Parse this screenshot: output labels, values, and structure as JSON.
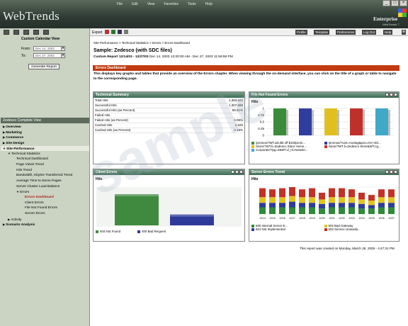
{
  "browser": {
    "menu": [
      "File",
      "Edit",
      "View",
      "Favorites",
      "Tools",
      "Help"
    ]
  },
  "brand": {
    "logo": "WebTrends",
    "edition": "Enterprise",
    "version": "WebTrends 7"
  },
  "left": {
    "title": "Custom Calendar View",
    "from_label": "From:",
    "from_value": "Dec 14, 2003",
    "to_label": "To:",
    "to_value": "Dec 27, 2003",
    "generate": "Generate Report",
    "profile": "Zedesco Complete View",
    "tree": [
      {
        "label": "Overview",
        "lvl": 0
      },
      {
        "label": "Marketing",
        "lvl": 0
      },
      {
        "label": "Commerce",
        "lvl": 0
      },
      {
        "label": "Site Design",
        "lvl": 0
      },
      {
        "label": "Site Performance",
        "lvl": 0,
        "sel": true
      },
      {
        "label": "Technical Statistics",
        "lvl": 1
      },
      {
        "label": "Technical Dashboard",
        "lvl": 2
      },
      {
        "label": "Page Views Trend",
        "lvl": 2
      },
      {
        "label": "Hits Trend",
        "lvl": 2
      },
      {
        "label": "Bandwidth, Kbytes Transferred Trend",
        "lvl": 2
      },
      {
        "label": "Average Time to Serve Pages",
        "lvl": 2
      },
      {
        "label": "Server Cluster Load Balance",
        "lvl": 2
      },
      {
        "label": "Errors",
        "lvl": 2
      },
      {
        "label": "Errors Dashboard",
        "lvl": 3,
        "hl": true
      },
      {
        "label": "Client Errors",
        "lvl": 3
      },
      {
        "label": "File Not Found Errors",
        "lvl": 3
      },
      {
        "label": "Server Errors",
        "lvl": 3
      },
      {
        "label": "Activity",
        "lvl": 1
      },
      {
        "label": "Scenario Analysis",
        "lvl": 0
      }
    ]
  },
  "topnav": {
    "export": "Export",
    "buttons": [
      "Profile",
      "Template",
      "Preferences",
      "Log Out",
      "Help"
    ]
  },
  "main": {
    "breadcrumb": "Site Performance > Technical Statistics > Errors > Errors Dashboard",
    "title": "Sample: Zedesco (with SDC files)",
    "custom_report": "Custom Report 12/14/03 - 12/27/03",
    "custom_range": "Dec 14, 2003 12:00:00 AM - Dec 27, 2003 11:59:59 PM",
    "banner": "Errors Dashboard",
    "description": "This displays key graphs and tables that provide an overview of the Errors chapter. When viewing through the on-demand interface, you can click on the title of a graph or table to navigate to the corresponding page.",
    "footer": "This report was created on Monday, March 28, 2005 - 4:47:31 PM"
  },
  "summary": {
    "title": "Technical Summary",
    "rows": [
      [
        "Total Hits",
        "1,383,622"
      ],
      [
        "Successful Hits",
        "1,307,688"
      ],
      [
        "Successful Hits (as Percent)",
        "99.91%"
      ],
      [
        "Failed Hits",
        ""
      ],
      [
        "Failed Hits (as Percent)",
        "0.09%"
      ],
      [
        "Cached Hits",
        "2,520"
      ],
      [
        "Cached Hits (as Percent)",
        "0.19%"
      ]
    ]
  },
  "fnf": {
    "title": "File Not Found Errors",
    "hits": "Hits",
    "yticks": [
      "1",
      "0.75",
      "0.5",
      "0.25",
      "0"
    ],
    "colors": [
      "#3a8c3a",
      "#2f3e9e",
      "#e0c020",
      "#c0302a",
      "#40a8c8"
    ],
    "values": [
      1,
      1,
      1,
      1,
      1
    ],
    "legend": [
      "/promos/?WT.ad=$5 off $100prom...",
      "/promos/?cart=Analog&pos=On+Vid...",
      "/store/?WT.li=Zedesco Store Home...",
      "/store/?WT.li=Zedesco Store&WT.cg...",
      "/corporate/?pg=4&WT.cl_nl=Newsle..."
    ]
  },
  "client": {
    "title": "Client Errors",
    "hits": "Hits",
    "chart_data": {
      "type": "bar",
      "categories": [
        "404 Not Found",
        "400 Bad Request"
      ],
      "values": [
        100,
        35
      ],
      "colors": [
        "#3f8a3f",
        "#2e3a9a"
      ]
    }
  },
  "server": {
    "title": "Server Errors Trend",
    "hits": "Hits",
    "chart_data": {
      "type": "bar",
      "stacked": true,
      "categories": [
        "12/14",
        "12/15",
        "12/16",
        "12/17",
        "12/18",
        "12/19",
        "12/20",
        "12/21",
        "12/22",
        "12/23",
        "12/24",
        "12/25",
        "12/26",
        "12/27"
      ],
      "series": [
        {
          "name": "500 Internal Server E...",
          "color": "#2f8a3a",
          "values": [
            6,
            6,
            6,
            6,
            6,
            6,
            5,
            6,
            6,
            6,
            5,
            5,
            6,
            6
          ]
        },
        {
          "name": "501 Not Implemented",
          "color": "#2e3c9a",
          "values": [
            4,
            4,
            4,
            5,
            4,
            4,
            4,
            4,
            4,
            4,
            4,
            3,
            4,
            4
          ]
        },
        {
          "name": "502 Bad Gateway",
          "color": "#e2c41e",
          "values": [
            5,
            5,
            5,
            5,
            5,
            5,
            4,
            5,
            5,
            5,
            4,
            4,
            5,
            5
          ]
        },
        {
          "name": "503 Service Unavaila...",
          "color": "#c33226",
          "values": [
            8,
            7,
            8,
            8,
            7,
            8,
            6,
            8,
            8,
            7,
            6,
            5,
            7,
            7
          ]
        }
      ]
    }
  }
}
